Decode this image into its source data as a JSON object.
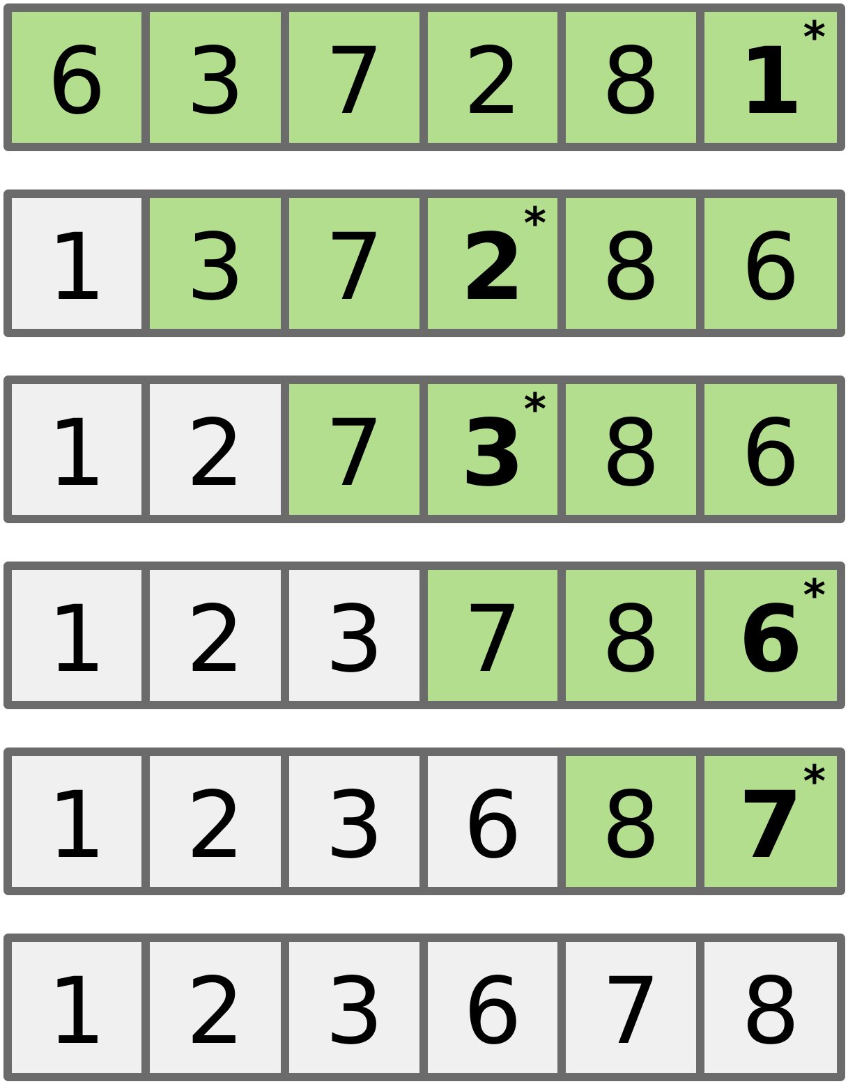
{
  "colors": {
    "unsorted_cell": "#b3de8e",
    "sorted_cell": "#f0f0f0",
    "border": "#6b6b6b",
    "text": "#000000"
  },
  "rows": [
    {
      "cells": [
        {
          "value": "6",
          "state": "unsorted",
          "marked": false
        },
        {
          "value": "3",
          "state": "unsorted",
          "marked": false
        },
        {
          "value": "7",
          "state": "unsorted",
          "marked": false
        },
        {
          "value": "2",
          "state": "unsorted",
          "marked": false
        },
        {
          "value": "8",
          "state": "unsorted",
          "marked": false
        },
        {
          "value": "1",
          "state": "unsorted",
          "marked": true,
          "mark": "*"
        }
      ]
    },
    {
      "cells": [
        {
          "value": "1",
          "state": "sorted",
          "marked": false
        },
        {
          "value": "3",
          "state": "unsorted",
          "marked": false
        },
        {
          "value": "7",
          "state": "unsorted",
          "marked": false
        },
        {
          "value": "2",
          "state": "unsorted",
          "marked": true,
          "mark": "*"
        },
        {
          "value": "8",
          "state": "unsorted",
          "marked": false
        },
        {
          "value": "6",
          "state": "unsorted",
          "marked": false
        }
      ]
    },
    {
      "cells": [
        {
          "value": "1",
          "state": "sorted",
          "marked": false
        },
        {
          "value": "2",
          "state": "sorted",
          "marked": false
        },
        {
          "value": "7",
          "state": "unsorted",
          "marked": false
        },
        {
          "value": "3",
          "state": "unsorted",
          "marked": true,
          "mark": "*"
        },
        {
          "value": "8",
          "state": "unsorted",
          "marked": false
        },
        {
          "value": "6",
          "state": "unsorted",
          "marked": false
        }
      ]
    },
    {
      "cells": [
        {
          "value": "1",
          "state": "sorted",
          "marked": false
        },
        {
          "value": "2",
          "state": "sorted",
          "marked": false
        },
        {
          "value": "3",
          "state": "sorted",
          "marked": false
        },
        {
          "value": "7",
          "state": "unsorted",
          "marked": false
        },
        {
          "value": "8",
          "state": "unsorted",
          "marked": false
        },
        {
          "value": "6",
          "state": "unsorted",
          "marked": true,
          "mark": "*"
        }
      ]
    },
    {
      "cells": [
        {
          "value": "1",
          "state": "sorted",
          "marked": false
        },
        {
          "value": "2",
          "state": "sorted",
          "marked": false
        },
        {
          "value": "3",
          "state": "sorted",
          "marked": false
        },
        {
          "value": "6",
          "state": "sorted",
          "marked": false
        },
        {
          "value": "8",
          "state": "unsorted",
          "marked": false
        },
        {
          "value": "7",
          "state": "unsorted",
          "marked": true,
          "mark": "*"
        }
      ]
    },
    {
      "cells": [
        {
          "value": "1",
          "state": "sorted",
          "marked": false
        },
        {
          "value": "2",
          "state": "sorted",
          "marked": false
        },
        {
          "value": "3",
          "state": "sorted",
          "marked": false
        },
        {
          "value": "6",
          "state": "sorted",
          "marked": false
        },
        {
          "value": "7",
          "state": "sorted",
          "marked": false
        },
        {
          "value": "8",
          "state": "sorted",
          "marked": false
        }
      ]
    }
  ]
}
